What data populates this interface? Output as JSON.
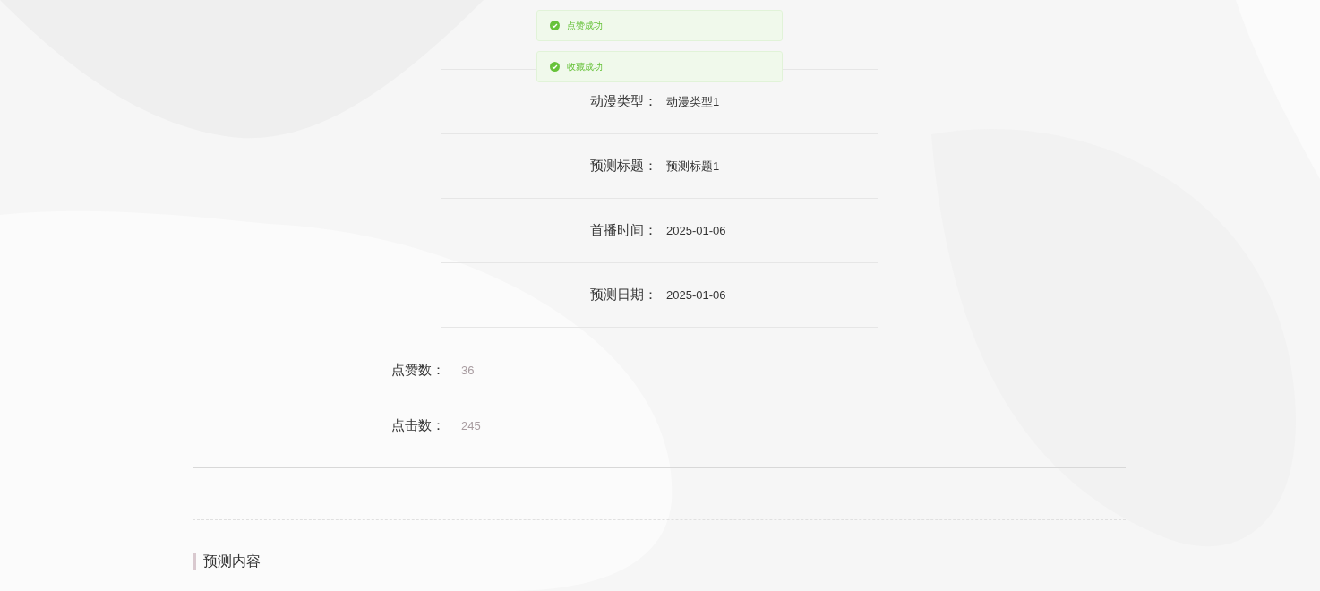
{
  "toasts": [
    {
      "kind": "success",
      "message": "点赞成功"
    },
    {
      "kind": "success",
      "message": "收藏成功"
    }
  ],
  "details": [
    {
      "label": "动漫类型：",
      "value": "动漫类型1"
    },
    {
      "label": "预测标题：",
      "value": "预测标题1"
    },
    {
      "label": "首播时间：",
      "value": "2025-01-06"
    },
    {
      "label": "预测日期：",
      "value": "2025-01-06"
    }
  ],
  "stats": [
    {
      "label": "点赞数：",
      "value": "36"
    },
    {
      "label": "点击数：",
      "value": "245"
    }
  ],
  "section": {
    "title": "预测内容"
  }
}
